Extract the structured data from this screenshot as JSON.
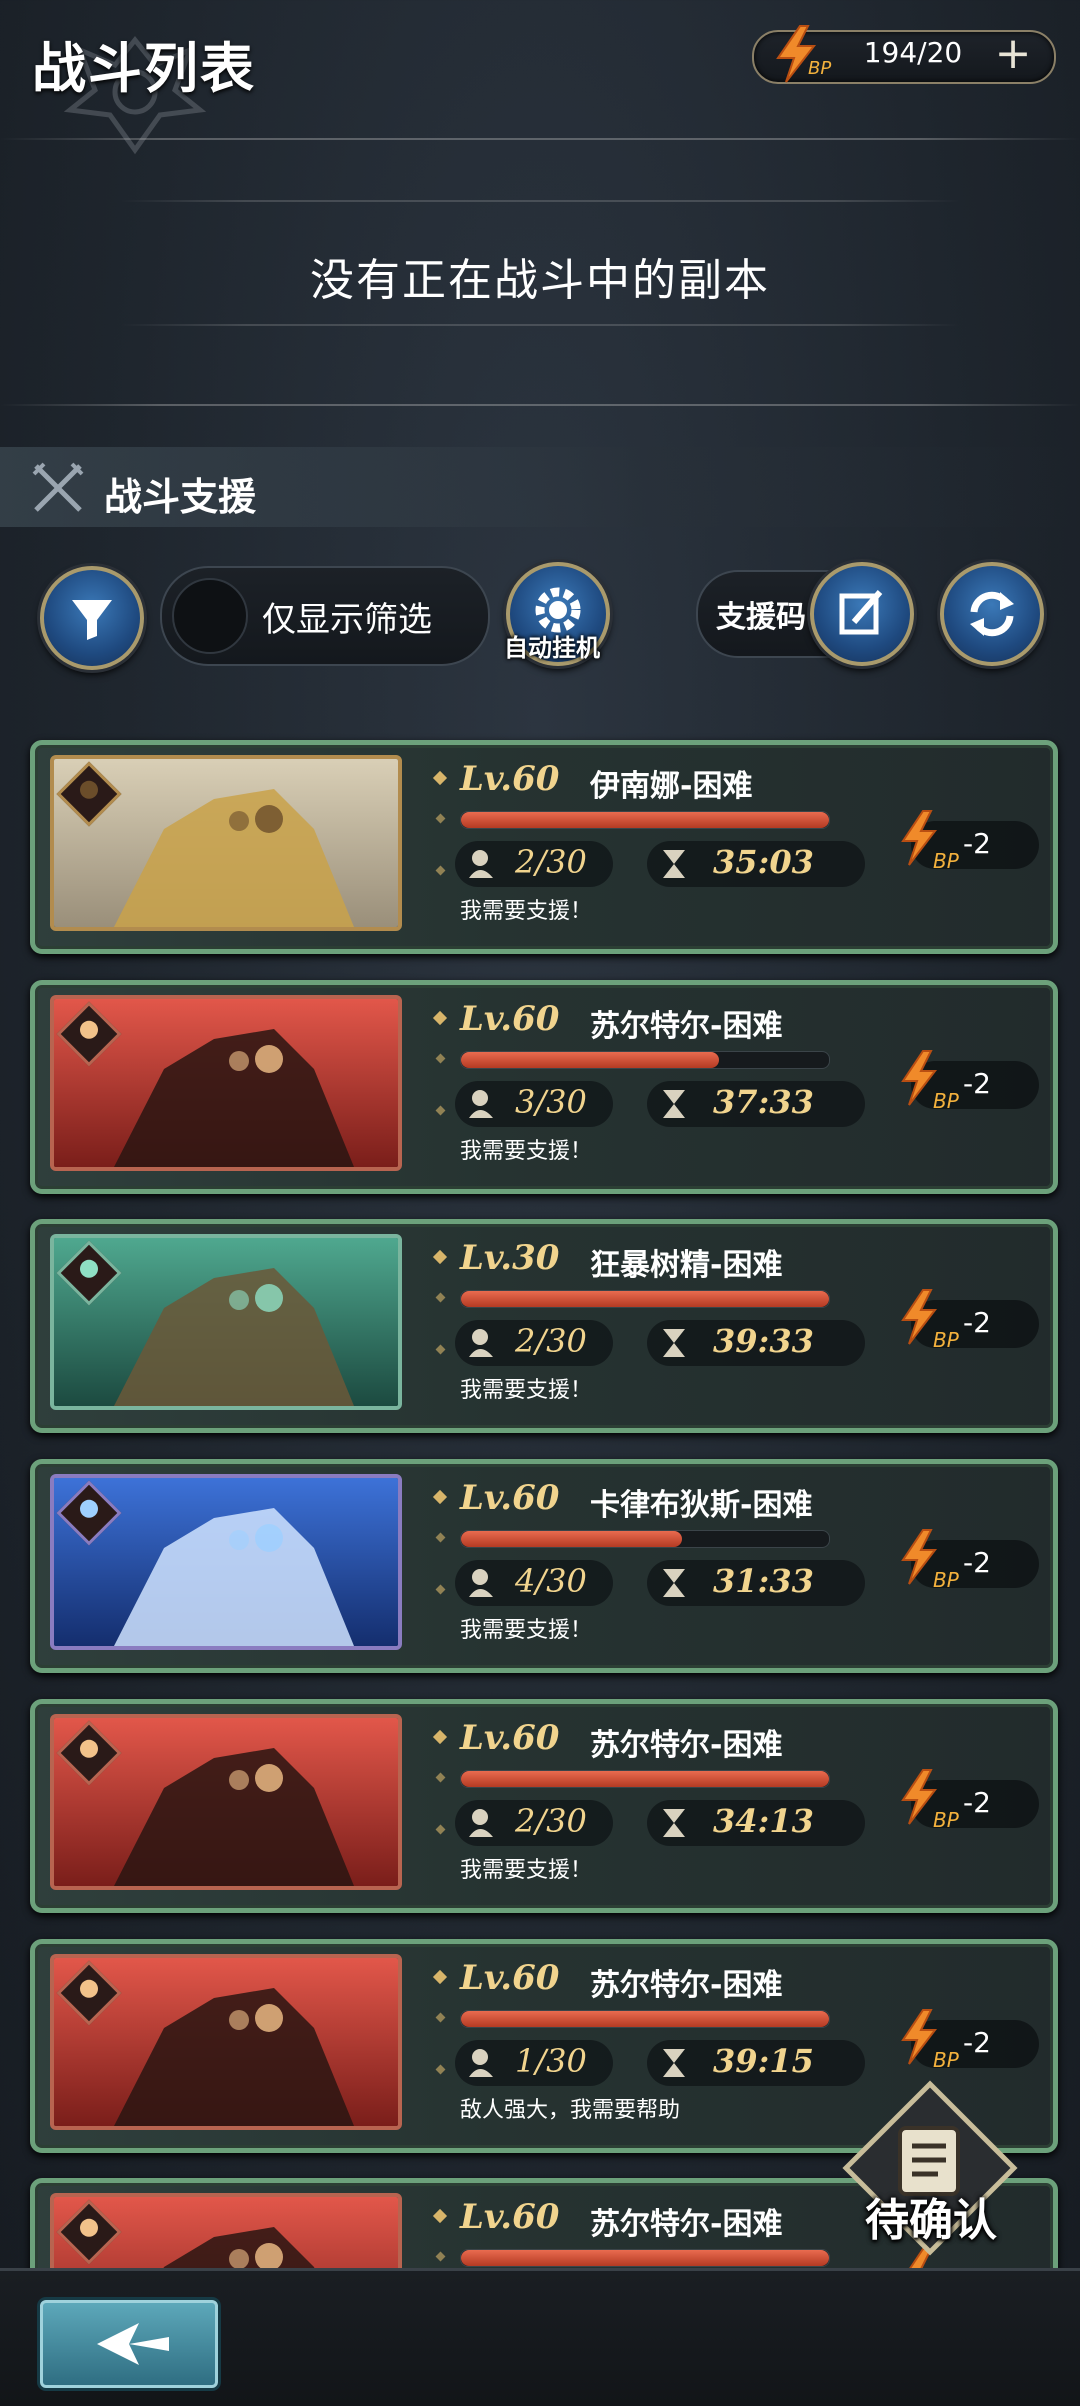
{
  "header": {
    "title": "战斗列表",
    "bp_label": "BP",
    "bp_value": "194/20",
    "add_symbol": "+"
  },
  "no_battle_text": "没有正在战斗中的副本",
  "section": {
    "title": "战斗支援"
  },
  "controls": {
    "filter_toggle_label": "仅显示筛选",
    "auto_label": "自动挂机",
    "support_code_label": "支援码"
  },
  "battles": [
    {
      "level": "Lv.60",
      "name": "伊南娜-困难",
      "players": "2/30",
      "timer": "35:03",
      "hp_fraction": 1.0,
      "message": "我需要支援！",
      "cost_label": "BP",
      "cost": "-2",
      "element": "earth"
    },
    {
      "level": "Lv.60",
      "name": "苏尔特尔-困难",
      "players": "3/30",
      "timer": "37:33",
      "hp_fraction": 0.7,
      "message": "我需要支援！",
      "cost_label": "BP",
      "cost": "-2",
      "element": "fire"
    },
    {
      "level": "Lv.30",
      "name": "狂暴树精-困难",
      "players": "2/30",
      "timer": "39:33",
      "hp_fraction": 1.0,
      "message": "我需要支援！",
      "cost_label": "BP",
      "cost": "-2",
      "element": "wind"
    },
    {
      "level": "Lv.60",
      "name": "卡律布狄斯-困难",
      "players": "4/30",
      "timer": "31:33",
      "hp_fraction": 0.6,
      "message": "我需要支援！",
      "cost_label": "BP",
      "cost": "-2",
      "element": "water"
    },
    {
      "level": "Lv.60",
      "name": "苏尔特尔-困难",
      "players": "2/30",
      "timer": "34:13",
      "hp_fraction": 1.0,
      "message": "我需要支援！",
      "cost_label": "BP",
      "cost": "-2",
      "element": "fire"
    },
    {
      "level": "Lv.60",
      "name": "苏尔特尔-困难",
      "players": "1/30",
      "timer": "39:15",
      "hp_fraction": 1.0,
      "message": "敌人强大，我需要帮助",
      "cost_label": "BP",
      "cost": "-2",
      "element": "fire"
    },
    {
      "level": "Lv.60",
      "name": "苏尔特尔-困难",
      "players": "",
      "timer": "",
      "hp_fraction": 1.0,
      "message": "",
      "cost_label": "",
      "cost": "",
      "element": "fire"
    }
  ],
  "pending": {
    "label": "待确认"
  },
  "colors": {
    "card_border": "#6ca17b",
    "hp_fill": "#d4553a",
    "gold_text": "#f1d48e",
    "bolt": "#f08a2a",
    "button_blue": "#2b5c96"
  },
  "icons": [
    "filter-icon",
    "gear-icon",
    "edit-icon",
    "refresh-icon",
    "bolt-icon",
    "player-icon",
    "hourglass-icon",
    "back-arrow-icon",
    "scroll-icon",
    "crossed-swords-icon"
  ]
}
